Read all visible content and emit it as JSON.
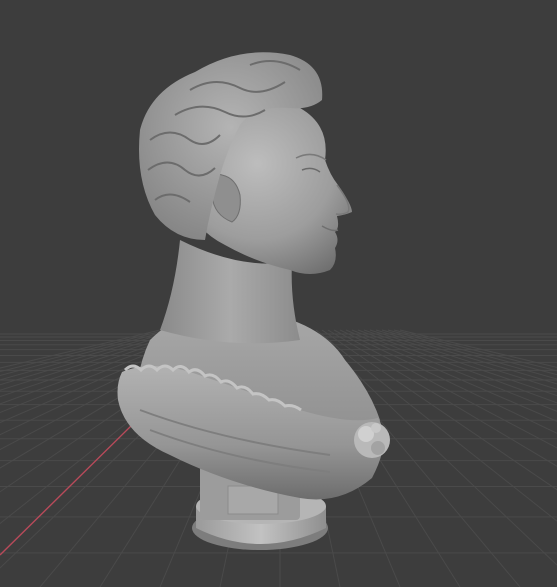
{
  "viewport": {
    "background": "#3d3d3d",
    "grid_color": "#4a4a4a",
    "x_axis_color": "#b84a5a"
  },
  "model": {
    "name": "bust-sculpture",
    "material_color": "#9b9b9b",
    "shadow_color": "#6e6e6e",
    "highlight_color": "#c9c9c9"
  }
}
